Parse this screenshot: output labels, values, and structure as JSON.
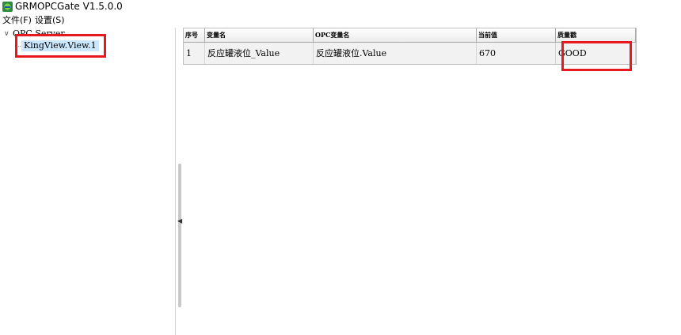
{
  "window": {
    "title": "GRMOPCGate  V1.5.0.0",
    "icon": "app-logo-icon"
  },
  "menu": {
    "items": [
      {
        "label": "文件(F)"
      },
      {
        "label": "设置(S)"
      }
    ]
  },
  "tree": {
    "root_label": "OPC Server",
    "child_label": "KingView.View.1",
    "toggle_icon": "chevron-down-icon"
  },
  "grid": {
    "columns": [
      "序号",
      "变量名",
      "OPC变量名",
      "当前值",
      "质量戳"
    ],
    "rows": [
      [
        "1",
        "反应罐液位_Value",
        "反应罐液位.Value",
        "670",
        "GOOD"
      ]
    ]
  },
  "colors": {
    "highlight_box": "#e8191e",
    "selection": "#cce8ff"
  }
}
